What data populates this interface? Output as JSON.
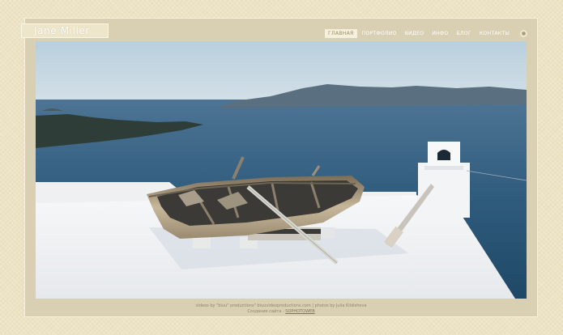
{
  "header": {
    "logo_text": "Jane Miller"
  },
  "nav": {
    "items": [
      {
        "label": "ГЛАВНАЯ",
        "active": true
      },
      {
        "label": "ПОРТФОЛИО",
        "active": false
      },
      {
        "label": "ВИДЕО",
        "active": false
      },
      {
        "label": "ИНФО",
        "active": false
      },
      {
        "label": "БЛОГ",
        "active": false
      },
      {
        "label": "КОНТАКТЫ",
        "active": false
      }
    ],
    "extra_icon": "globe-icon"
  },
  "hero": {
    "image_subject": "old wooden rowboat on white rooftop overlooking sea"
  },
  "footer": {
    "credits": "videos by \"bluu\" productions\" bluuvideoproductions.com | photos by Julia Kildisheva",
    "made_prefix": "Создание сайта - ",
    "made_link": "SOPHOTOWEB"
  },
  "colors": {
    "background": "#ece3c4",
    "frame": "#d9cfb2",
    "active_tab": "#f5efdb",
    "sea": "#2e5a7d",
    "sky": "#c5d7e3"
  }
}
